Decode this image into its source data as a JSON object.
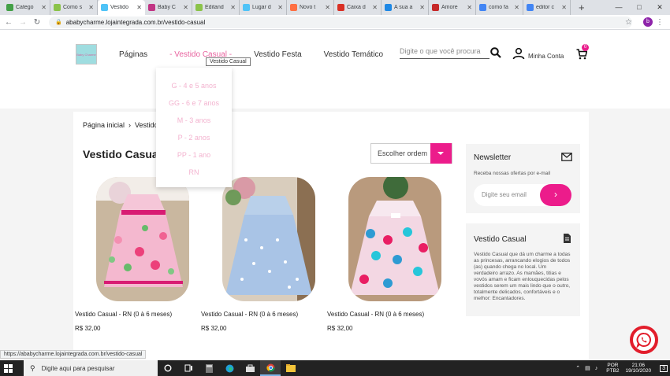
{
  "browser": {
    "tabs": [
      {
        "title": "Catego",
        "color": "#43a047"
      },
      {
        "title": "Como s",
        "color": "#8bc34a"
      },
      {
        "title": "Vestido",
        "color": "#4fc3f7",
        "active": true
      },
      {
        "title": "Baby C",
        "color": "#c13584"
      },
      {
        "title": "Editand",
        "color": "#8bc34a"
      },
      {
        "title": "Lugar d",
        "color": "#4fc3f7"
      },
      {
        "title": "Novo t",
        "color": "#ff7043"
      },
      {
        "title": "Caixa d",
        "color": "#d93025"
      },
      {
        "title": "A sua a",
        "color": "#1e88e5"
      },
      {
        "title": "Amore",
        "color": "#c62828"
      },
      {
        "title": "como fa",
        "color": "#4285f4"
      },
      {
        "title": "editor c",
        "color": "#4285f4"
      }
    ],
    "new_tab": "+",
    "url": "ababycharme.lojaintegrada.com.br/vestido-casual",
    "profile_initial": "b"
  },
  "header": {
    "logo_text": "Baby Charme",
    "menu": [
      "Páginas",
      "Vestido Casual",
      "Vestido Festa",
      "Vestido Temático"
    ],
    "tooltip": "Vestido Casual",
    "search_placeholder": "Digite o que você procura",
    "account_label": "Minha Conta",
    "cart_count": "0"
  },
  "dropdown": [
    "G - 4 e 5 anos",
    "GG - 6 e 7 anos",
    "M - 3 anos",
    "P - 2 anos",
    "PP - 1 ano",
    "RN"
  ],
  "breadcrumb": {
    "home": "Página inicial",
    "separator": "›",
    "current": "Vestido Casual"
  },
  "category_title": "Vestido Casual",
  "sort_label": "Escolher ordem",
  "products": [
    {
      "name": "Vestido Casual - RN (0 à 6 meses)",
      "price": "R$ 32,00"
    },
    {
      "name": "Vestido Casual - RN (0 à 6 meses)",
      "price": "R$ 32,00"
    },
    {
      "name": "Vestido Casual - RN (0 à 6 meses)",
      "price": "R$ 32,00"
    }
  ],
  "newsletter": {
    "title": "Newsletter",
    "description": "Receba nossas ofertas por e-mail",
    "placeholder": "Digite seu email",
    "submit_symbol": "›"
  },
  "info": {
    "title": "Vestido Casual",
    "text": "Vestido Casual que dá um charme a todas as princesas, arrancando elogios de todos (as) quando chega no local. Um verdadeiro arrazo. As mamães, titias e vovós amam e ficam enlouquecidas pelos vestidos serem um mais lindo que o outro, totalmente delicados, confortáveis e o melhor: Encantadores."
  },
  "status_url": "https://ababycharme.lojaintegrada.com.br/vestido-casual",
  "taskbar": {
    "search_text": "Digite aqui para pesquisar",
    "lang_top": "POR",
    "lang_bottom": "PTB2",
    "time": "21:06",
    "date": "19/10/2020",
    "notifications": "3"
  },
  "colors": {
    "accent": "#ec1c8b",
    "menu_active": "#e8639f",
    "dropdown_text": "#f3b3cf"
  }
}
